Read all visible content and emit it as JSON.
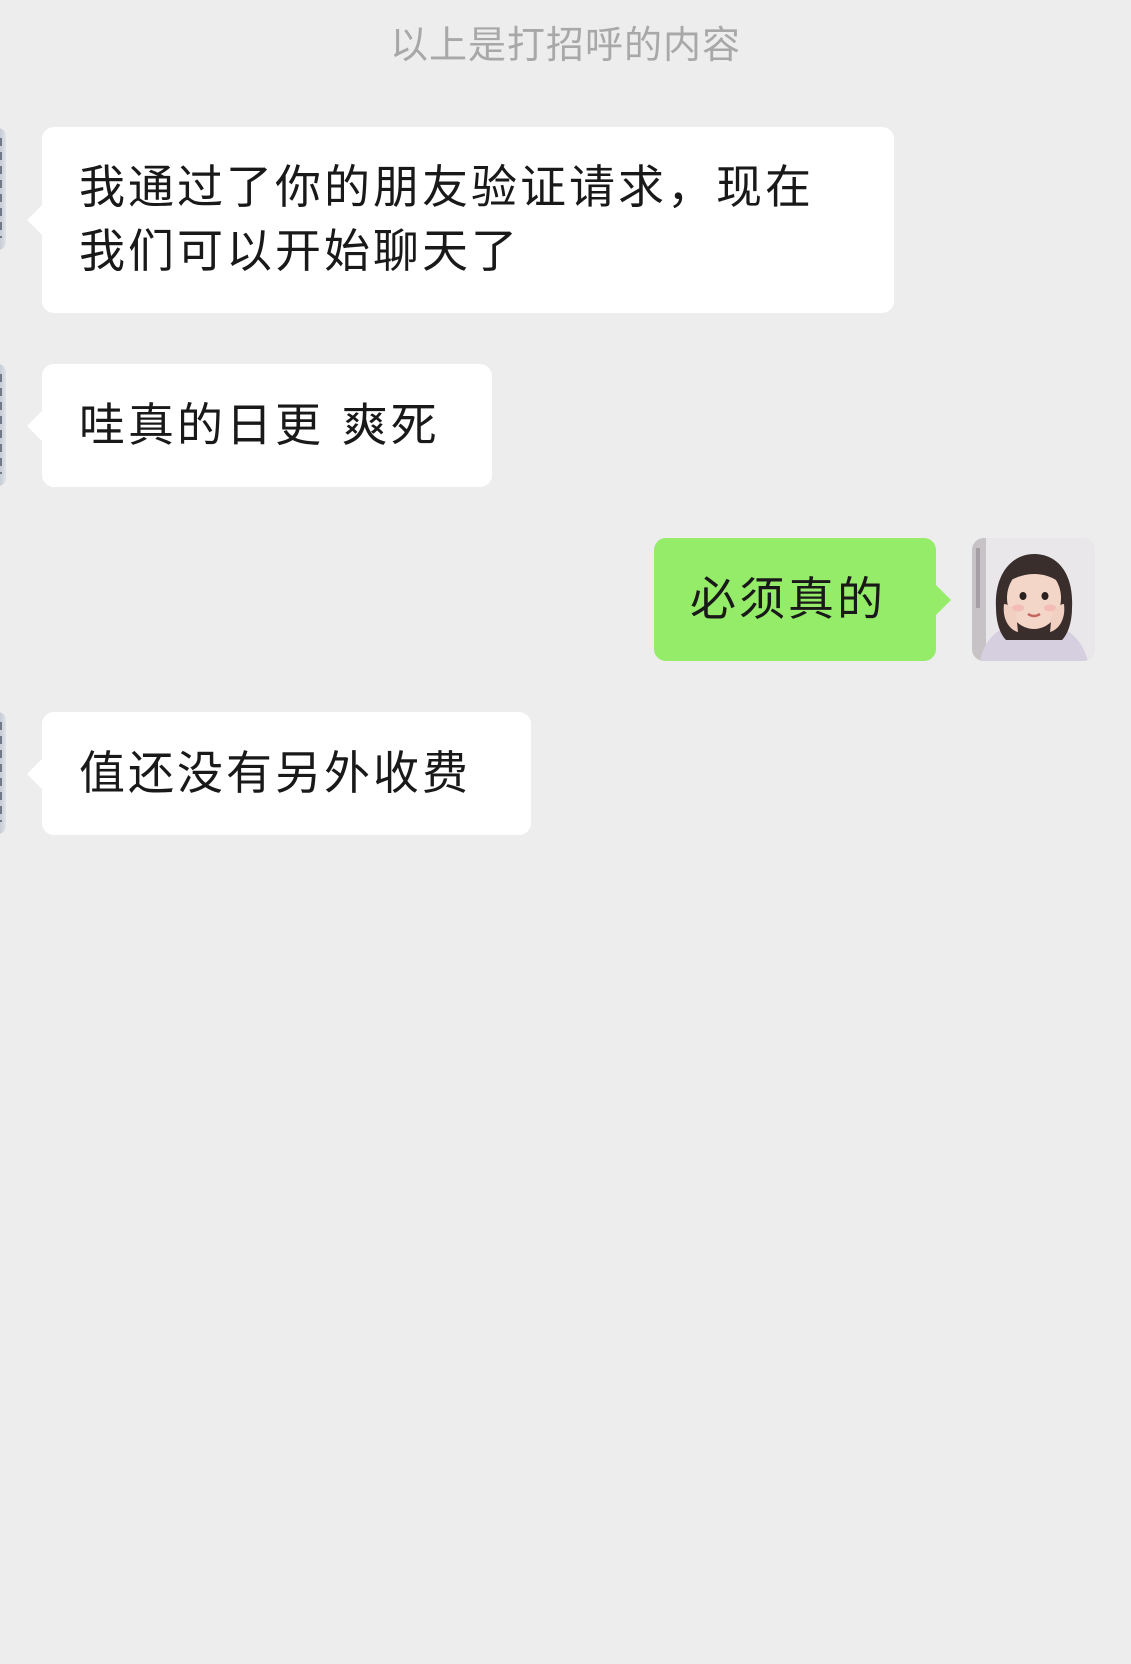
{
  "system_notice": "以上是打招呼的内容",
  "messages": [
    {
      "side": "incoming",
      "text": "我通过了你的朋友验证请求，现在\n我们可以开始聊天了"
    },
    {
      "side": "incoming",
      "text": "哇真的日更 爽死"
    },
    {
      "side": "outgoing",
      "text": "必须真的"
    },
    {
      "side": "incoming",
      "text": "值还没有另外收费"
    }
  ],
  "colors": {
    "background": "#ededed",
    "incoming_bubble": "#ffffff",
    "outgoing_bubble": "#95ec69",
    "notice_text": "#a8a8a8",
    "message_text": "#191919"
  }
}
